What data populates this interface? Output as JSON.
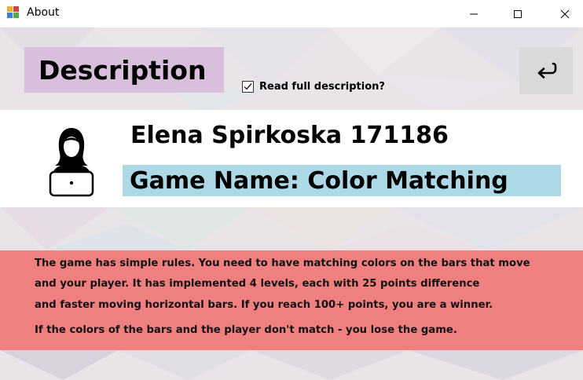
{
  "window": {
    "title": "About",
    "controls": [
      "minimize",
      "maximize",
      "close"
    ]
  },
  "header": {
    "description_label": "Description",
    "checkbox_label": "Read full description?",
    "checkbox_checked": true,
    "back_icon": "return-arrow-icon"
  },
  "profile": {
    "author": "Elena Spirkoska 171186",
    "game_name": "Game Name: Color Matching",
    "avatar_icon": "person-laptop-icon"
  },
  "rules": {
    "lines": [
      "The game has simple rules. You need to have matching colors on the bars that move",
      "and your player.  It has implemented 4 levels, each with 25 points difference",
      "and faster moving horizontal bars. If you reach 100+ points, you are a winner.",
      "If the colors of the bars and the player don't match - you lose the game."
    ]
  },
  "colors": {
    "description_bg": "#d8bfdc",
    "game_name_bg": "#add8e6",
    "rules_bg": "#f08080",
    "back_button_bg": "#d9d9d9"
  }
}
